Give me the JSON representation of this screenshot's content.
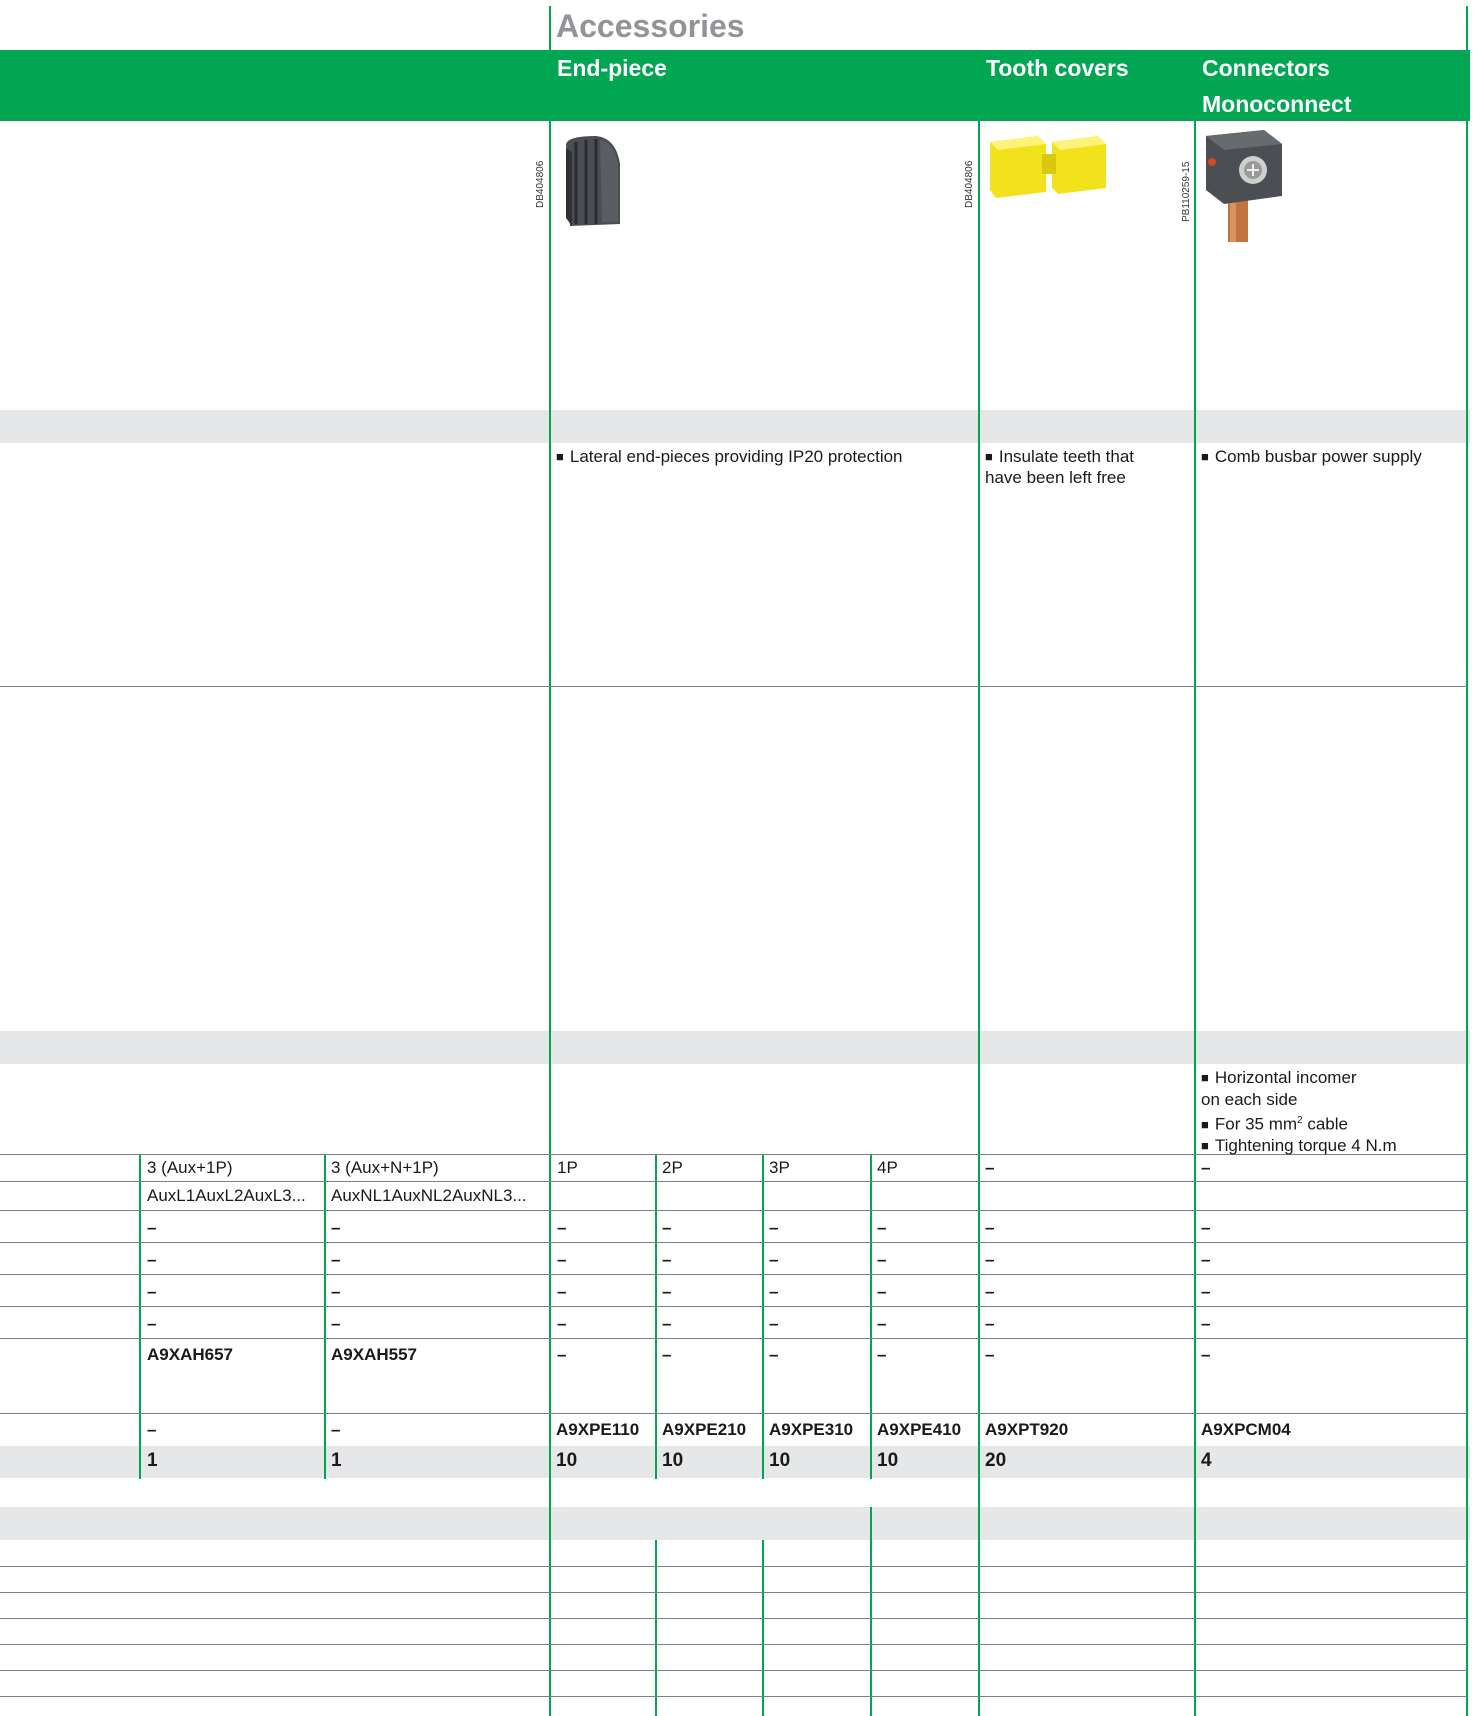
{
  "section_title": "Accessories",
  "columns": {
    "end_piece": "End-piece",
    "tooth_covers": "Tooth covers",
    "connectors_line1": "Connectors",
    "connectors_line2": "Monoconnect"
  },
  "image_refs": {
    "end_piece": "DB404806",
    "tooth_covers": "DB404806",
    "connectors": "PB110259-15"
  },
  "descriptions": {
    "end_piece": "Lateral end-pieces providing IP20 protection",
    "tooth_covers_line1": "Insulate teeth that",
    "tooth_covers_line2": "have been left free",
    "connectors": "Comb busbar power supply"
  },
  "connector_specs": {
    "line1": "Horizontal incomer",
    "line2": "on each side",
    "line3a": "For 35 mm",
    "line3sup": "2",
    "line3b": " cable",
    "line4": "Tightening torque 4 N.m"
  },
  "poles_row": [
    "3 (Aux+1P)",
    "3 (Aux+N+1P)",
    "1P",
    "2P",
    "3P",
    "4P",
    "–",
    "–"
  ],
  "phase_row": [
    "AuxL1AuxL2AuxL3...",
    "AuxNL1AuxNL2AuxNL3..."
  ],
  "dash": "–",
  "aux_refs": [
    "A9XAH657",
    "A9XAH557"
  ],
  "main_refs": [
    "–",
    "–",
    "A9XPE110",
    "A9XPE210",
    "A9XPE310",
    "A9XPE410",
    "A9XPT920",
    "A9XPCM04"
  ],
  "quantities": [
    "1",
    "1",
    "10",
    "10",
    "10",
    "10",
    "20",
    "4"
  ],
  "colors": {
    "brand_green": "#00a651",
    "band_gray": "#e6e7e8",
    "title_gray": "#929497"
  }
}
